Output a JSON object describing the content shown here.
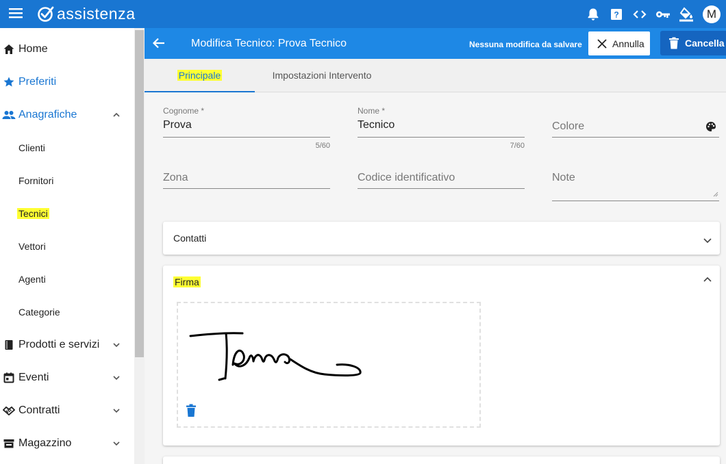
{
  "app": {
    "brand": "assistenza",
    "avatar_initial": "M",
    "accent": "#1976d2",
    "icons": [
      "menu-icon",
      "bell-icon",
      "help-icon",
      "code-icon",
      "key-icon",
      "paint-bucket-icon"
    ]
  },
  "sidebar": {
    "items": [
      {
        "label": "Home",
        "icon": "home-icon"
      },
      {
        "label": "Preferiti",
        "icon": "star-icon"
      },
      {
        "label": "Anagrafiche",
        "icon": "people-icon",
        "expanded": true
      },
      {
        "label": "Prodotti e servizi",
        "icon": "book-icon"
      },
      {
        "label": "Eventi",
        "icon": "calendar-icon"
      },
      {
        "label": "Contratti",
        "icon": "handshake-icon"
      },
      {
        "label": "Magazzino",
        "icon": "warehouse-icon"
      }
    ],
    "sub_items": [
      "Clienti",
      "Fornitori",
      "Tecnici",
      "Vettori",
      "Agenti",
      "Categorie"
    ],
    "selected_sub_item": "Tecnici"
  },
  "toolbar": {
    "title": "Modifica Tecnico: Prova Tecnico",
    "status": "Nessuna modifica da salvare",
    "cancel_label": "Annulla",
    "delete_label": "Cancella"
  },
  "tabs": [
    {
      "label": "Principale",
      "active": true
    },
    {
      "label": "Impostazioni Intervento",
      "active": false
    }
  ],
  "form": {
    "cognome": {
      "label": "Cognome *",
      "value": "Prova",
      "counter": "5/60"
    },
    "nome": {
      "label": "Nome *",
      "value": "Tecnico",
      "counter": "7/60"
    },
    "colore": {
      "placeholder": "Colore"
    },
    "zona": {
      "placeholder": "Zona"
    },
    "codice": {
      "placeholder": "Codice identificativo"
    },
    "note": {
      "placeholder": "Note"
    }
  },
  "panels": {
    "contatti": {
      "title": "Contatti",
      "expanded": false
    },
    "firma": {
      "title": "Firma",
      "expanded": true
    }
  }
}
